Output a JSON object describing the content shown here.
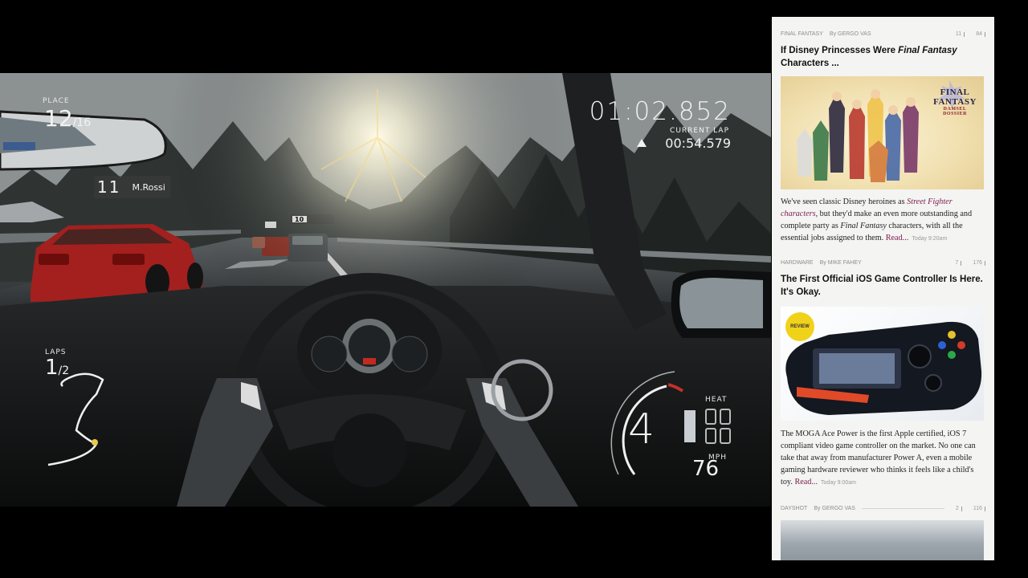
{
  "game": {
    "place_label": "PLACE",
    "place_current": "12",
    "place_total": "/16",
    "lap_time": "01:02.852",
    "current_lap_label": "CURRENT LAP",
    "current_lap_time": "00:54.579",
    "rival_position": "11",
    "rival_name": "M.Rossi",
    "laps_label": "LAPS",
    "laps_current": "1",
    "laps_total": "/2",
    "gear": "4",
    "heat_label": "HEAT",
    "speed_unit": "MPH",
    "speed": "76",
    "track_sign": "10"
  },
  "panel": {
    "articles": [
      {
        "category": "FINAL FANTASY",
        "author": "By GERGO VAS",
        "comments": "11",
        "views": "84",
        "title_pre": "If Disney Princesses Were ",
        "title_em": "Final Fantasy",
        "title_post": " Characters ...",
        "image_logo_line1": "FINAL FANTASY",
        "image_logo_line2": "DAMSEL DOSSIER",
        "body_1": "We've seen classic Disney heroines as ",
        "body_link": "Street Fighter characters",
        "body_2": ", but they'd make an even more outstanding and complete party as ",
        "body_em": "Final Fantasy",
        "body_3": " characters, with all the essential jobs assigned to them. ",
        "read": "Read...",
        "time": "Today 9:20am"
      },
      {
        "category": "HARDWARE",
        "author": "By MIKE FAHEY",
        "comments": "7",
        "views": "176",
        "title": "The First Official iOS Game Controller Is Here. It's Okay.",
        "badge": "REVIEW",
        "body": "The MOGA Ace Power is the first Apple certified, iOS 7 compliant video game controller on the market. No one can take that away from manufacturer Power A, even a mobile gaming hardware reviewer who thinks it feels like a child's toy. ",
        "read": "Read...",
        "time": "Today 9:00am"
      },
      {
        "category": "DAYSHOT",
        "author": "By GERGO VAS",
        "comments": "2",
        "views": "116"
      }
    ]
  }
}
